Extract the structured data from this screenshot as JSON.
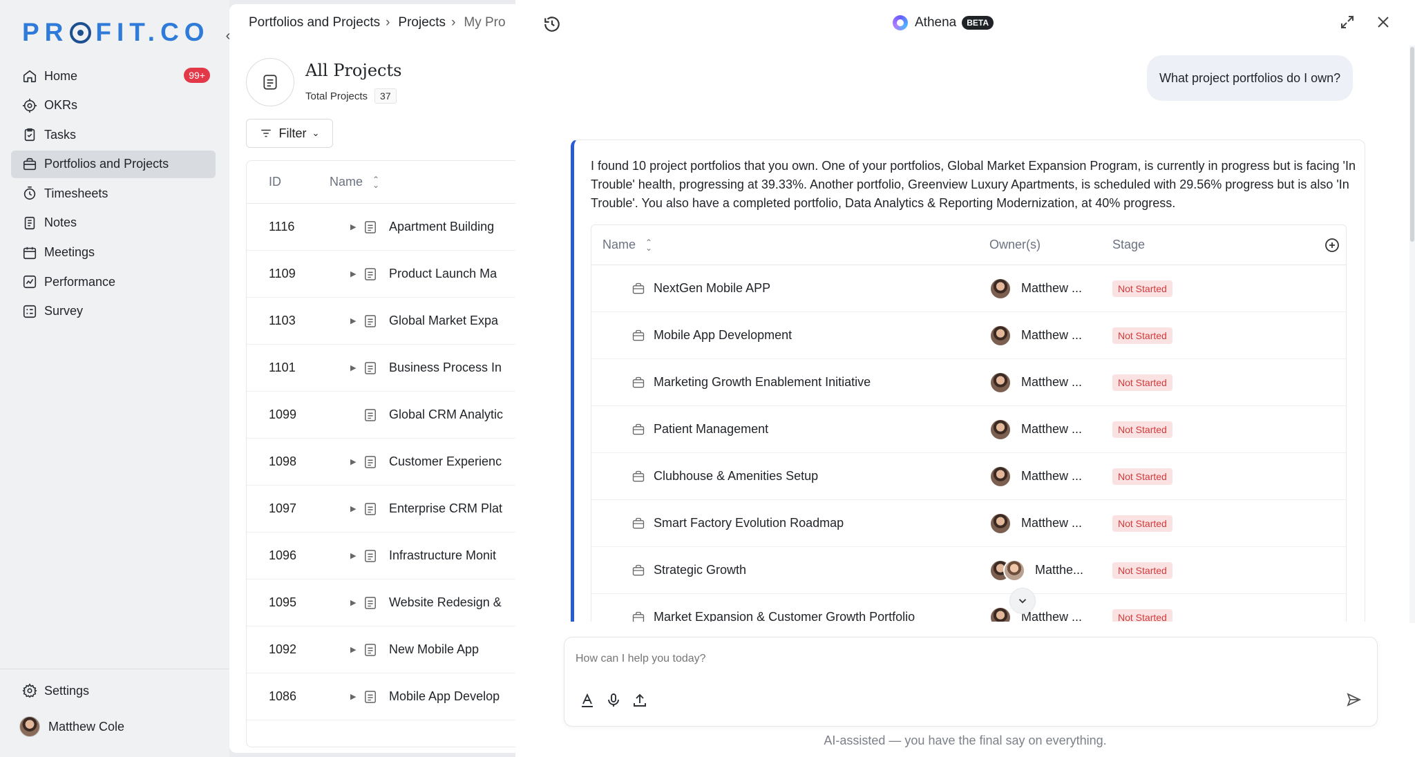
{
  "sidebar": {
    "logo": "PR●FIT.CO",
    "logo_parts": [
      "PR",
      "FIT.CO"
    ],
    "items": [
      {
        "label": "Home",
        "icon": "home-icon",
        "badge": "99+"
      },
      {
        "label": "OKRs",
        "icon": "target-icon"
      },
      {
        "label": "Tasks",
        "icon": "tasks-icon"
      },
      {
        "label": "Portfolios and Projects",
        "icon": "briefcase-icon",
        "active": true
      },
      {
        "label": "Timesheets",
        "icon": "timer-icon"
      },
      {
        "label": "Notes",
        "icon": "notes-icon"
      },
      {
        "label": "Meetings",
        "icon": "calendar-icon"
      },
      {
        "label": "Performance",
        "icon": "performance-icon"
      },
      {
        "label": "Survey",
        "icon": "survey-icon"
      }
    ],
    "settings_label": "Settings",
    "user_name": "Matthew Cole"
  },
  "main": {
    "breadcrumb": [
      "Portfolios and Projects",
      "Projects",
      "My Pro"
    ],
    "title": "All Projects",
    "total_label": "Total Projects",
    "total_count": "37",
    "filter_label": "Filter",
    "columns": {
      "id": "ID",
      "name": "Name"
    },
    "rows": [
      {
        "id": "1116",
        "name": "Apartment Building",
        "expandable": true
      },
      {
        "id": "1109",
        "name": "Product Launch Ma",
        "expandable": true
      },
      {
        "id": "1103",
        "name": "Global Market Expa",
        "expandable": true
      },
      {
        "id": "1101",
        "name": "Business Process In",
        "expandable": true
      },
      {
        "id": "1099",
        "name": "Global CRM Analytic",
        "expandable": false
      },
      {
        "id": "1098",
        "name": "Customer Experienc",
        "expandable": true
      },
      {
        "id": "1097",
        "name": "Enterprise CRM Plat",
        "expandable": true
      },
      {
        "id": "1096",
        "name": "Infrastructure Monit",
        "expandable": true
      },
      {
        "id": "1095",
        "name": "Website Redesign &",
        "expandable": true
      },
      {
        "id": "1092",
        "name": "New Mobile App",
        "expandable": true
      },
      {
        "id": "1086",
        "name": "Mobile App Develop",
        "expandable": true
      }
    ]
  },
  "panel": {
    "title": "Athena",
    "beta": "BETA",
    "user_message": "What project portfolios do I own?",
    "response_text": "I found 10 project portfolios that you own. One of your portfolios, Global Market Expansion Program, is currently in progress but is facing 'In Trouble' health, progressing at 39.33%. Another portfolio, Greenview Luxury Apartments, is scheduled with 29.56% progress but is also 'In Trouble'. You also have a completed portfolio, Data Analytics & Reporting Modernization, at 40% progress.",
    "table": {
      "columns": {
        "name": "Name",
        "owner": "Owner(s)",
        "stage": "Stage"
      },
      "rows": [
        {
          "name": "NextGen Mobile APP",
          "owner": "Matthew ...",
          "stage": "Not Started",
          "multi": false
        },
        {
          "name": "Mobile App Development",
          "owner": "Matthew ...",
          "stage": "Not Started",
          "multi": false
        },
        {
          "name": "Marketing Growth Enablement Initiative",
          "owner": "Matthew ...",
          "stage": "Not Started",
          "multi": false
        },
        {
          "name": "Patient Management",
          "owner": "Matthew ...",
          "stage": "Not Started",
          "multi": false
        },
        {
          "name": "Clubhouse & Amenities Setup",
          "owner": "Matthew ...",
          "stage": "Not Started",
          "multi": false
        },
        {
          "name": "Smart Factory Evolution Roadmap",
          "owner": "Matthew ...",
          "stage": "Not Started",
          "multi": false
        },
        {
          "name": "Strategic Growth",
          "owner": "Matthe...",
          "stage": "Not Started",
          "multi": true
        },
        {
          "name": "Market Expansion & Customer Growth Portfolio",
          "owner": "Matthew ...",
          "stage": "Not Started",
          "multi": false
        }
      ]
    },
    "composer_placeholder": "How can I help you today?",
    "disclaimer": "AI-assisted — you have the final say on everything."
  },
  "colors": {
    "accent": "#2a5bd7",
    "badge": "#e23848",
    "stage_bg": "#fbe2e2",
    "stage_text": "#d23a3a",
    "logo": "#2f7bd9"
  }
}
